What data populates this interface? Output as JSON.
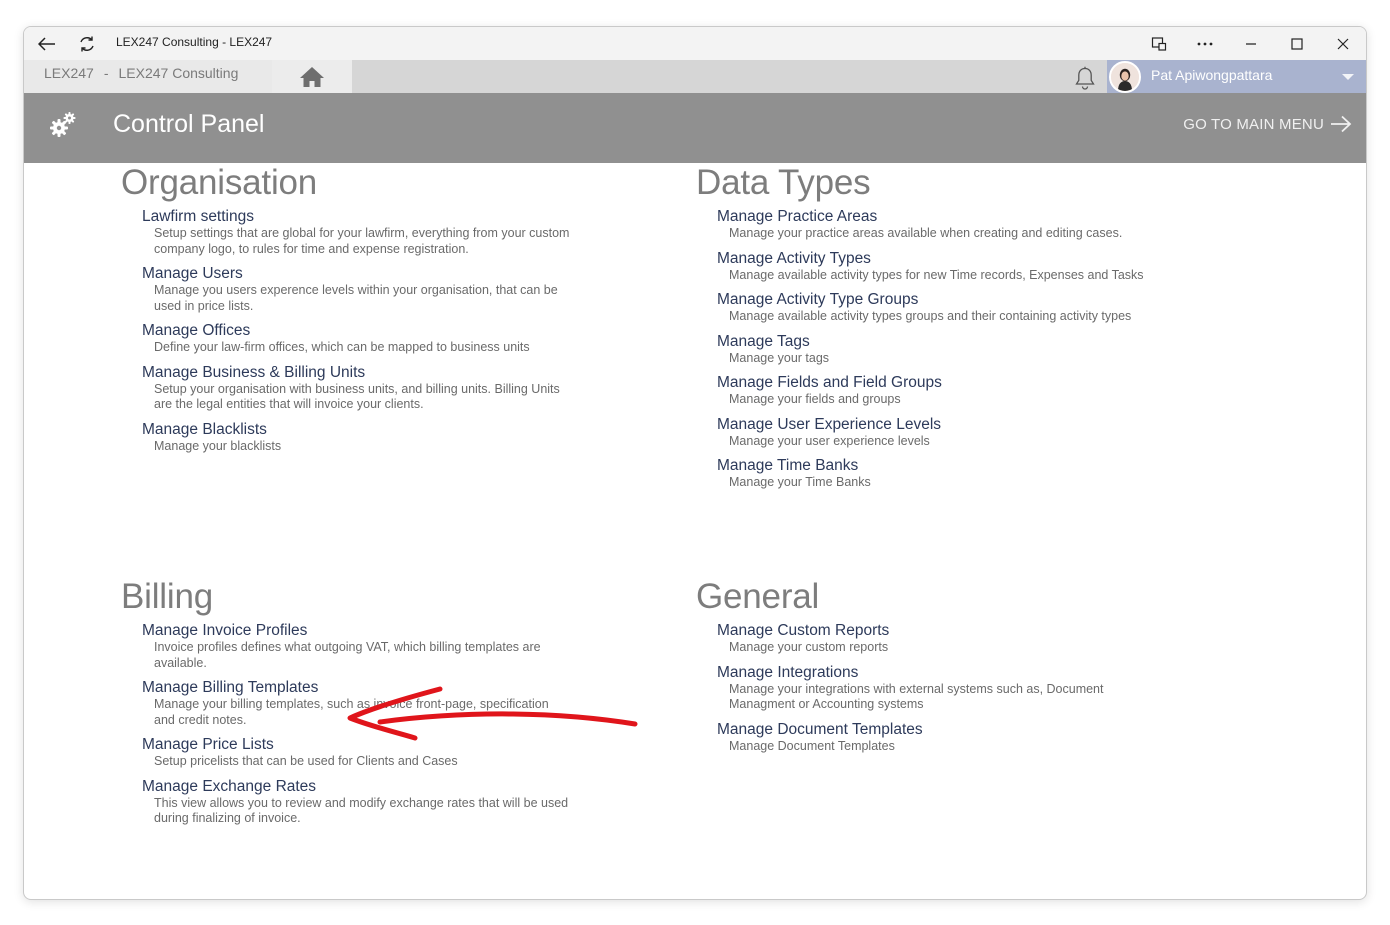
{
  "window": {
    "title": "LEX247 Consulting - LEX247"
  },
  "tabbar": {
    "tab_prefix": "LEX247",
    "tab_sep": "-",
    "tab_name": "LEX247 Consulting",
    "user_name": "Pat Apiwongpattara"
  },
  "header": {
    "title": "Control Panel",
    "main_menu": "GO TO MAIN MENU"
  },
  "sections": [
    {
      "title": "Organisation",
      "items": [
        {
          "title": "Lawfirm settings",
          "desc": "Setup settings that are global for your lawfirm, everything from your custom company logo, to rules for time and expense registration."
        },
        {
          "title": "Manage Users",
          "desc": "Manage you users experence levels within your organisation, that can be used in price lists."
        },
        {
          "title": "Manage Offices",
          "desc": "Define your law-firm offices, which can be mapped to business units"
        },
        {
          "title": "Manage Business & Billing Units",
          "desc": "Setup your organisation with business units, and billing units. Billing Units are the legal entities that will invoice your clients."
        },
        {
          "title": "Manage Blacklists",
          "desc": "Manage your blacklists"
        }
      ]
    },
    {
      "title": "Data Types",
      "items": [
        {
          "title": "Manage Practice Areas",
          "desc": "Manage your practice areas available when creating and editing cases."
        },
        {
          "title": "Manage Activity Types",
          "desc": "Manage available activity types for new Time records, Expenses and Tasks"
        },
        {
          "title": "Manage Activity Type Groups",
          "desc": "Manage available activity types groups and their containing activity types"
        },
        {
          "title": "Manage Tags",
          "desc": "Manage your tags"
        },
        {
          "title": "Manage Fields and Field Groups",
          "desc": "Manage your fields and groups"
        },
        {
          "title": "Manage User Experience Levels",
          "desc": "Manage your user experience levels"
        },
        {
          "title": "Manage Time Banks",
          "desc": "Manage your Time Banks"
        }
      ]
    },
    {
      "title": "Billing",
      "items": [
        {
          "title": "Manage Invoice Profiles",
          "desc": "Invoice profiles defines what outgoing VAT, which billing templates are available."
        },
        {
          "title": "Manage Billing Templates",
          "desc": "Manage your billing templates, such as invoice front-page, specification and credit notes."
        },
        {
          "title": "Manage Price Lists",
          "desc": "Setup pricelists that can be used for Clients and Cases"
        },
        {
          "title": "Manage Exchange Rates",
          "desc": "This view allows you to review and modify exchange rates that will be used during finalizing of invoice."
        }
      ]
    },
    {
      "title": "General",
      "items": [
        {
          "title": "Manage Custom Reports",
          "desc": "Manage your custom reports"
        },
        {
          "title": "Manage Integrations",
          "desc": "Manage your integrations with external systems such as, Document Managment or Accounting systems"
        },
        {
          "title": "Manage Document Templates",
          "desc": "Manage Document Templates"
        }
      ]
    }
  ],
  "colors": {
    "header_bg": "#909090",
    "user_area_bg": "#a9b3cf",
    "link_color": "#2d3a5a",
    "annotation_arrow": "#e0151b"
  },
  "icons": [
    "back-arrow-icon",
    "refresh-icon",
    "cast-icon",
    "more-icon",
    "minimize-icon",
    "maximize-icon",
    "close-icon",
    "home-icon",
    "bell-icon",
    "gear-icon",
    "arrow-right-icon"
  ]
}
